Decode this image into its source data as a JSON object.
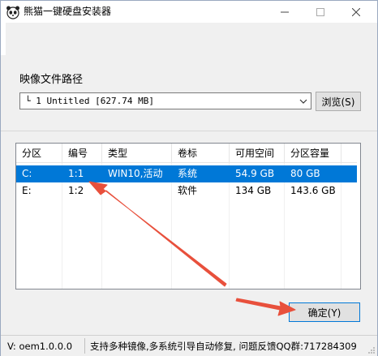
{
  "window": {
    "title": "熊猫一键硬盘安装器",
    "controls": {
      "minimize": "—",
      "maximize": "☐",
      "close": "✕"
    }
  },
  "image_path": {
    "label": "映像文件路径",
    "selected_value": "└ 1 Untitled [627.74 MB]",
    "browse_button": "浏览(S)"
  },
  "partition_table": {
    "columns": [
      "分区",
      "编号",
      "类型",
      "卷标",
      "可用空间",
      "分区容量"
    ],
    "rows": [
      {
        "partition": "C:",
        "number": "1:1",
        "type": "WIN10,活动",
        "label": "系统",
        "free": "54.9 GB",
        "capacity": "80 GB",
        "selected": true
      },
      {
        "partition": "E:",
        "number": "1:2",
        "type": "",
        "label": "软件",
        "free": "134 GB",
        "capacity": "143.6 GB",
        "selected": false
      }
    ]
  },
  "confirm_button": "确定(Y)",
  "status": {
    "version": "V:  oem1.0.0.0",
    "message": "支持多种镜像,多系统引导自动修复, 问题反馈QQ群:717284309"
  },
  "colors": {
    "selection": "#0078d7",
    "annotation_arrow": "#e8503c",
    "window_bg": "#f0f0f0"
  },
  "icons": {
    "app": "panda-icon",
    "dropdown": "chevron-down-icon",
    "resize": "resize-grip-icon"
  }
}
